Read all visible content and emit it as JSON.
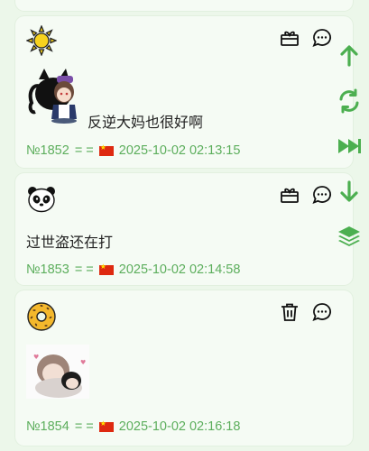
{
  "posts": [
    {
      "avatar": "sun-avatar",
      "actions": [
        "gift-icon",
        "comment-icon"
      ],
      "message": "反逆大妈也很好啊",
      "image": "anime-character-sticker",
      "number": "№1852",
      "sep": "= =",
      "flag": "china-flag-icon",
      "timestamp": "2025-10-02 02:13:15"
    },
    {
      "avatar": "panda-avatar",
      "actions": [
        "gift-icon",
        "comment-icon"
      ],
      "message": "过世盗还在打",
      "number": "№1853",
      "sep": "= =",
      "flag": "china-flag-icon",
      "timestamp": "2025-10-02 02:14:58"
    },
    {
      "avatar": "donut-avatar",
      "actions": [
        "trash-icon",
        "comment-icon"
      ],
      "message": "",
      "image": "anime-sticker",
      "number": "№1854",
      "sep": "= =",
      "flag": "china-flag-icon",
      "timestamp": "2025-10-02 02:16:18"
    }
  ],
  "sidebar": [
    "arrow-up-icon",
    "refresh-icon",
    "fast-forward-icon",
    "arrow-down-icon",
    "layers-icon"
  ],
  "colors": {
    "accent": "#4caf50",
    "meta_text": "#5cae5c",
    "background": "#ecf7ea",
    "card": "#f5fbf4"
  }
}
